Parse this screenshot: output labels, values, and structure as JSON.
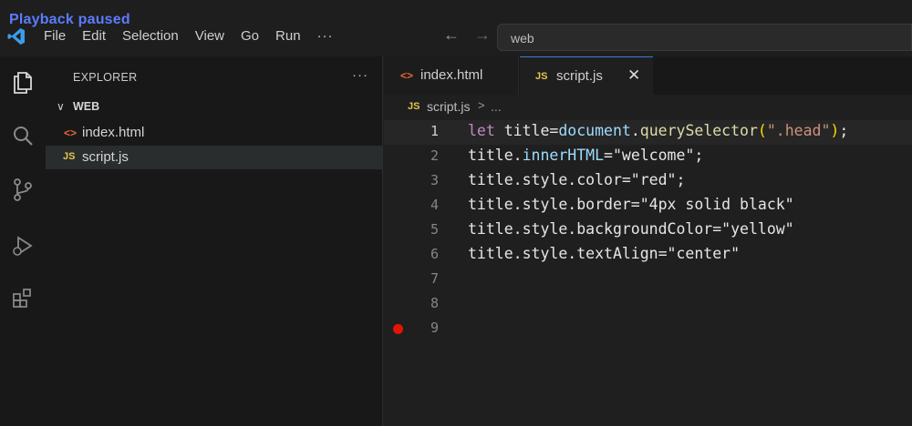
{
  "overlay": {
    "text": "Playback paused"
  },
  "menu": {
    "items": [
      "File",
      "Edit",
      "Selection",
      "View",
      "Go",
      "Run",
      "···"
    ]
  },
  "nav": {
    "back": "←",
    "forward": "→"
  },
  "search": {
    "text": "web"
  },
  "explorer": {
    "title": "EXPLORER",
    "more": "···",
    "folder": {
      "chevron": "∨",
      "name": "WEB"
    },
    "files": [
      {
        "icon": "<>",
        "name": "index.html"
      },
      {
        "icon": "JS",
        "name": "script.js"
      }
    ]
  },
  "tabs": [
    {
      "icon": "<>",
      "label": "index.html"
    },
    {
      "icon": "JS",
      "label": "script.js",
      "close": "✕"
    }
  ],
  "breadcrumb": {
    "icon": "JS",
    "file": "script.js",
    "sep": ">",
    "rest": "..."
  },
  "editor": {
    "line_numbers": [
      "1",
      "2",
      "3",
      "4",
      "5",
      "6",
      "7",
      "8",
      "9"
    ],
    "lines": [
      [
        {
          "t": "let",
          "c": "kw"
        },
        {
          "t": " ",
          "c": "plain"
        },
        {
          "t": "title",
          "c": "plain"
        },
        {
          "t": "=",
          "c": "plain"
        },
        {
          "t": "document",
          "c": "var"
        },
        {
          "t": ".",
          "c": "plain"
        },
        {
          "t": "querySelector",
          "c": "fn"
        },
        {
          "t": "(",
          "c": "paren"
        },
        {
          "t": "\".head\"",
          "c": "str"
        },
        {
          "t": ")",
          "c": "paren"
        },
        {
          "t": ";",
          "c": "plain"
        }
      ],
      [
        {
          "t": "title.",
          "c": "plain"
        },
        {
          "t": "innerHTML",
          "c": "prop"
        },
        {
          "t": "=\"welcome\";",
          "c": "plain"
        }
      ],
      [
        {
          "t": "title.style.color=\"red\";",
          "c": "plain"
        }
      ],
      [
        {
          "t": "title.style.border=\"4px solid black\"",
          "c": "plain"
        }
      ],
      [
        {
          "t": "title.style.backgroundColor=\"yellow\"",
          "c": "plain"
        }
      ],
      [
        {
          "t": "title.style.textAlign=\"center\"",
          "c": "plain"
        }
      ],
      [],
      [],
      []
    ],
    "current_line": 1,
    "breakpoint_line": 9
  },
  "colors": {
    "accent": "#3c7ad6",
    "breakpoint": "#e51400",
    "js_icon": "#e5c64b",
    "html_icon": "#e8643a"
  },
  "icons": [
    "vscode-logo-icon",
    "files-icon",
    "search-icon",
    "source-control-icon",
    "run-debug-icon",
    "extensions-icon"
  ]
}
